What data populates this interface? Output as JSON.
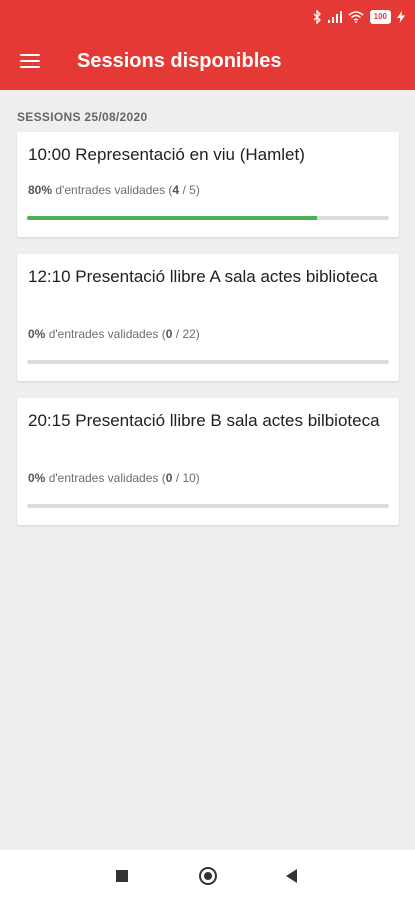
{
  "status_bar": {
    "battery": "100",
    "icons": [
      "bluetooth-icon",
      "signal-icon",
      "wifi-icon",
      "battery-icon",
      "charging-icon"
    ]
  },
  "app_bar": {
    "title": "Sessions disponibles",
    "menu_icon": "hamburger-menu-icon",
    "color": "#e53935"
  },
  "section": {
    "header": "SESSIONS 25/08/2020"
  },
  "sessions": [
    {
      "title": "10:00 Representació en viu (Hamlet)",
      "percent_label": "80%",
      "stat_text": "d'entrades validades",
      "validated": "4",
      "total": "5",
      "progress": 0.8
    },
    {
      "title": "12:10 Presentació llibre A sala actes biblioteca",
      "percent_label": "0%",
      "stat_text": "d'entrades validades",
      "validated": "0",
      "total": "22",
      "progress": 0
    },
    {
      "title": "20:15 Presentació llibre B sala actes bilbioteca",
      "percent_label": "0%",
      "stat_text": "d'entrades validades",
      "validated": "0",
      "total": "10",
      "progress": 0
    }
  ],
  "colors": {
    "accent": "#e53935",
    "progress": "#4caf50",
    "track": "#dcdcdc",
    "background": "#efefef"
  },
  "nav_bar": {
    "icons": [
      "recents-square-icon",
      "home-circle-icon",
      "back-triangle-icon"
    ]
  }
}
